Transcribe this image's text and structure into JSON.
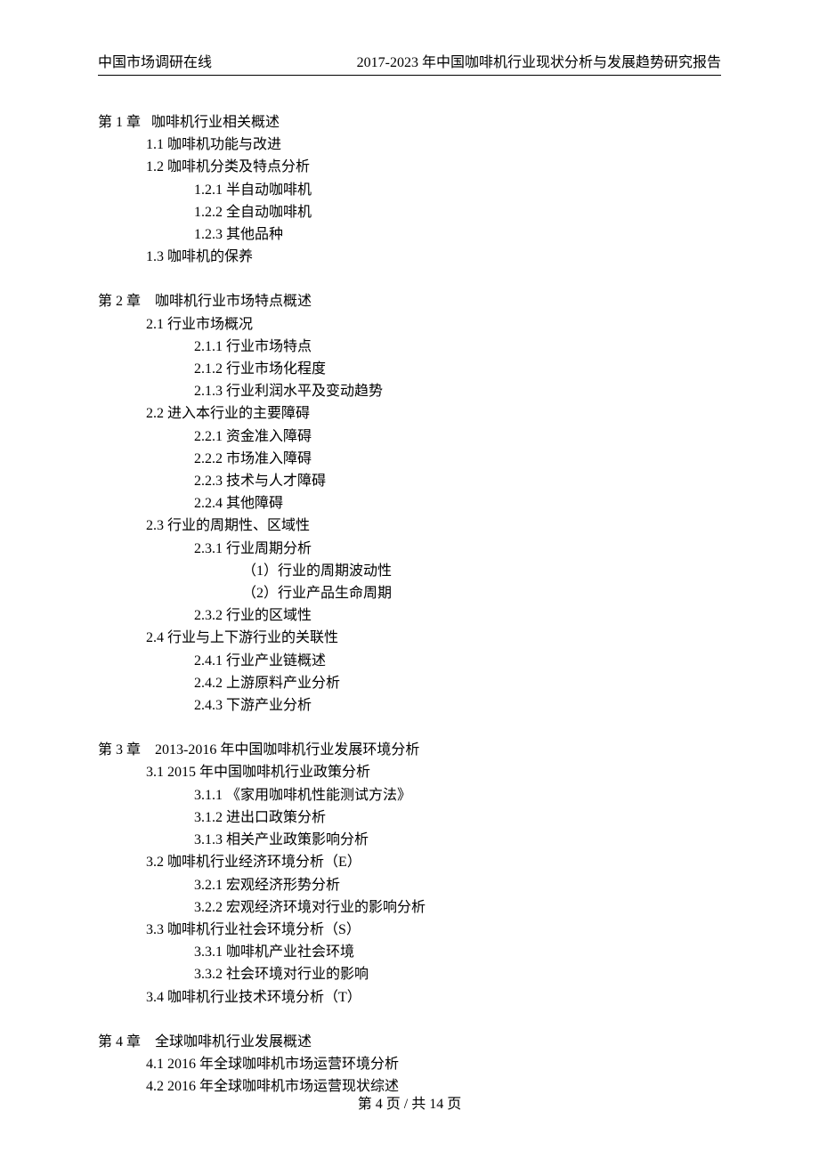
{
  "header": {
    "left": "中国市场调研在线",
    "right": "2017-2023 年中国咖啡机行业现状分析与发展趋势研究报告"
  },
  "chapters": [
    {
      "title": "第 1 章   咖啡机行业相关概述",
      "items": [
        {
          "level": 1,
          "text": "1.1 咖啡机功能与改进"
        },
        {
          "level": 1,
          "text": "1.2 咖啡机分类及特点分析"
        },
        {
          "level": 2,
          "text": "1.2.1 半自动咖啡机"
        },
        {
          "level": 2,
          "text": "1.2.2 全自动咖啡机"
        },
        {
          "level": 2,
          "text": "1.2.3 其他品种"
        },
        {
          "level": 1,
          "text": "1.3 咖啡机的保养"
        }
      ]
    },
    {
      "title": "第 2 章    咖啡机行业市场特点概述",
      "items": [
        {
          "level": 1,
          "text": "2.1 行业市场概况"
        },
        {
          "level": 2,
          "text": "2.1.1 行业市场特点"
        },
        {
          "level": 2,
          "text": "2.1.2 行业市场化程度"
        },
        {
          "level": 2,
          "text": "2.1.3 行业利润水平及变动趋势"
        },
        {
          "level": 1,
          "text": "2.2 进入本行业的主要障碍"
        },
        {
          "level": 2,
          "text": "2.2.1 资金准入障碍"
        },
        {
          "level": 2,
          "text": "2.2.2 市场准入障碍"
        },
        {
          "level": 2,
          "text": "2.2.3 技术与人才障碍"
        },
        {
          "level": 2,
          "text": "2.2.4 其他障碍"
        },
        {
          "level": 1,
          "text": "2.3 行业的周期性、区域性"
        },
        {
          "level": 2,
          "text": "2.3.1 行业周期分析"
        },
        {
          "level": 3,
          "text": "（1）行业的周期波动性"
        },
        {
          "level": 3,
          "text": "（2）行业产品生命周期"
        },
        {
          "level": 2,
          "text": "2.3.2 行业的区域性"
        },
        {
          "level": 1,
          "text": "2.4 行业与上下游行业的关联性"
        },
        {
          "level": 2,
          "text": "2.4.1 行业产业链概述"
        },
        {
          "level": 2,
          "text": "2.4.2 上游原料产业分析"
        },
        {
          "level": 2,
          "text": "2.4.3 下游产业分析"
        }
      ]
    },
    {
      "title": "第 3 章    2013-2016 年中国咖啡机行业发展环境分析",
      "items": [
        {
          "level": 1,
          "text": "3.1 2015 年中国咖啡机行业政策分析"
        },
        {
          "level": 2,
          "text": "3.1.1 《家用咖啡机性能测试方法》"
        },
        {
          "level": 2,
          "text": "3.1.2 进出口政策分析"
        },
        {
          "level": 2,
          "text": "3.1.3 相关产业政策影响分析"
        },
        {
          "level": 1,
          "text": "3.2 咖啡机行业经济环境分析（E）"
        },
        {
          "level": 2,
          "text": "3.2.1 宏观经济形势分析"
        },
        {
          "level": 2,
          "text": "3.2.2 宏观经济环境对行业的影响分析"
        },
        {
          "level": 1,
          "text": "3.3 咖啡机行业社会环境分析（S）"
        },
        {
          "level": 2,
          "text": "3.3.1 咖啡机产业社会环境"
        },
        {
          "level": 2,
          "text": "3.3.2 社会环境对行业的影响"
        },
        {
          "level": 1,
          "text": "3.4 咖啡机行业技术环境分析（T）"
        }
      ]
    },
    {
      "title": "第 4 章    全球咖啡机行业发展概述",
      "items": [
        {
          "level": 1,
          "text": "4.1 2016 年全球咖啡机市场运营环境分析"
        },
        {
          "level": 1,
          "text": "4.2 2016 年全球咖啡机市场运营现状综述"
        }
      ]
    }
  ],
  "footer": {
    "text": "第 4 页 / 共 14 页"
  }
}
